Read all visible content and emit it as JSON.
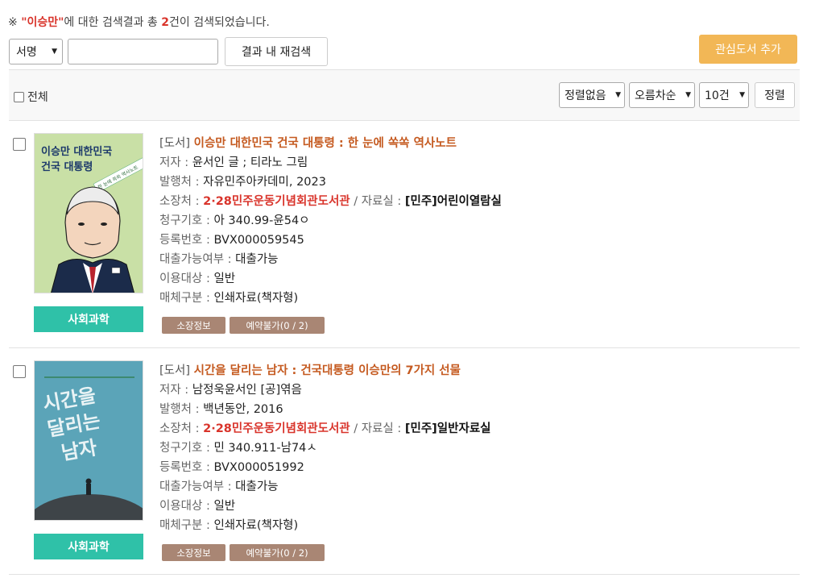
{
  "summary": {
    "prefix": "※ ",
    "quote_open": "\"",
    "keyword": "이승만",
    "quote_close": "\"",
    "mid": "에 대한 검색결과 총 ",
    "count": "2",
    "suffix": "건이 검색되었습니다."
  },
  "search": {
    "field_select": "서명",
    "query_value": "",
    "research_button": "결과 내 재검색"
  },
  "interest_button": "관심도서 추가",
  "toolbar": {
    "select_all_label": "전체",
    "sort_field": "정렬없음",
    "sort_order": "오름차순",
    "page_size": "10건",
    "sort_button": "정렬"
  },
  "labels": {
    "author": "저자 : ",
    "publisher": "발행처 : ",
    "holding": "소장처 : ",
    "room": " / 자료실 : ",
    "call_no": "청구기호 : ",
    "reg_no": "등록번호 : ",
    "loan": "대출가능여부 : ",
    "target": "이용대상 : ",
    "media": "매체구분 : "
  },
  "results": [
    {
      "type": "[도서] ",
      "title": "이승만 대한민국 건국 대통령 : 한 눈에 쏙쏙 역사노트",
      "author": "윤서인 글 ; 티라노 그림",
      "publisher": "자유민주아카데미, 2023",
      "holding": "2·28민주운동기념회관도서관",
      "room": "[민주]어린이열람실",
      "call_no": "아 340.99-윤54ㅇ",
      "reg_no": "BVX000059545",
      "loan": "대출가능",
      "target": "일반",
      "media": "인쇄자료(책자형)",
      "category": "사회과학",
      "btn_holding": "소장정보",
      "btn_reserve": "예약불가(0 / 2)",
      "cover_title_1": "이승만 대한민국",
      "cover_title_2": "건국 대통령",
      "cover_ribbon": "한 눈에 쏙쏙 역사노트",
      "cover_color": "#c9e0a6"
    },
    {
      "type": "[도서] ",
      "title": "시간을 달리는 남자 : 건국대통령 이승만의 7가지 선물",
      "author": "남정욱윤서인 [공]엮음",
      "publisher": "백년동안, 2016",
      "holding": "2·28민주운동기념회관도서관",
      "room": "[민주]일반자료실",
      "call_no": "민 340.911-남74ㅅ",
      "reg_no": "BVX000051992",
      "loan": "대출가능",
      "target": "일반",
      "media": "인쇄자료(책자형)",
      "category": "사회과학",
      "btn_holding": "소장정보",
      "btn_reserve": "예약불가(0 / 2)",
      "cover_title_1": "시간을",
      "cover_title_2": "달리는",
      "cover_title_3": "남자",
      "cover_color": "#5ba4b8"
    }
  ]
}
